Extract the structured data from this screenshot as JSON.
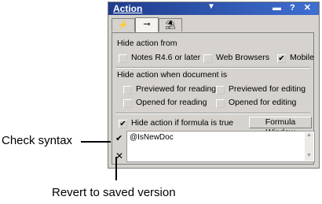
{
  "panel": {
    "title": "Action",
    "dropdown_glyph": "▼",
    "title_buttons": "▬ ? ✕",
    "tabs": [
      {
        "icon": "⚡",
        "name": "lightning-icon"
      },
      {
        "icon": "⊸",
        "name": "hide-when-icon"
      },
      {
        "icon": "⛱",
        "name": "advanced-icon"
      }
    ]
  },
  "hide_from": {
    "heading": "Hide action from",
    "options": [
      {
        "label": "Notes R4.6 or later",
        "checked": false
      },
      {
        "label": "Web Browsers",
        "checked": false
      },
      {
        "label": "Mobile",
        "checked": true
      }
    ]
  },
  "hide_when_doc": {
    "heading": "Hide action when document is",
    "options": [
      {
        "label": "Previewed for reading",
        "checked": false
      },
      {
        "label": "Previewed for editing",
        "checked": false
      },
      {
        "label": "Opened for reading",
        "checked": false
      },
      {
        "label": "Opened for editing",
        "checked": false
      }
    ]
  },
  "formula": {
    "checkbox_label": "Hide action if formula is true",
    "checked": true,
    "window_button": "Formula Window",
    "text": "@IsNewDoc",
    "check_syntax_glyph": "✔",
    "revert_glyph": "✕"
  },
  "callouts": {
    "check_syntax": "Check syntax",
    "revert": "Revert to saved version"
  },
  "check_mark": "✔"
}
